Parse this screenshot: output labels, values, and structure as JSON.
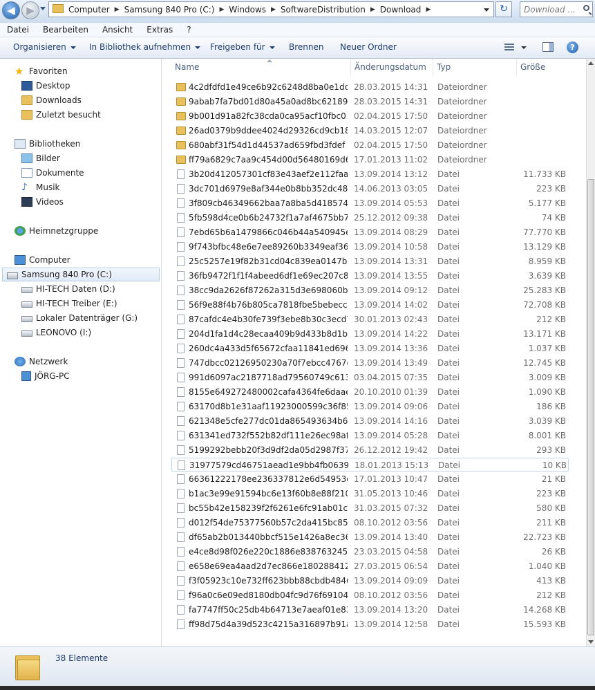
{
  "address": {
    "breadcrumbs": [
      "Computer",
      "Samsung 840 Pro (C:)",
      "Windows",
      "SoftwareDistribution",
      "Download"
    ],
    "search_placeholder": "Download ...",
    "refresh_symbol": "↻"
  },
  "nav_buttons": {
    "back": "◀",
    "forward": "▶"
  },
  "menu": [
    "Datei",
    "Bearbeiten",
    "Ansicht",
    "Extras",
    "?"
  ],
  "commands": {
    "organize": "Organisieren",
    "library": "In Bibliothek aufnehmen",
    "share": "Freigeben für",
    "burn": "Brennen",
    "new_folder": "Neuer Ordner",
    "help": "?"
  },
  "nav": {
    "favorites": "Favoriten",
    "desktop": "Desktop",
    "downloads": "Downloads",
    "recent": "Zuletzt besucht",
    "libraries": "Bibliotheken",
    "pictures": "Bilder",
    "documents": "Dokumente",
    "music": "Musik",
    "videos": "Videos",
    "homegroup": "Heimnetzgruppe",
    "computer": "Computer",
    "drive_c": "Samsung 840 Pro (C:)",
    "drive_d": "HI-TECH Daten (D:)",
    "drive_e": "HI-TECH Treiber (E:)",
    "drive_g": "Lokaler Datenträger (G:)",
    "drive_i": "LEONOVO (I:)",
    "network": "Netzwerk",
    "network_pc": "JÖRG-PC"
  },
  "columns": {
    "name": "Name",
    "date": "Änderungsdatum",
    "type": "Typ",
    "size": "Größe"
  },
  "files": [
    {
      "name": "4c2dfdfd1e49ce6b92c6248d8ba0e1dc",
      "date": "28.03.2015 14:31",
      "type": "Dateiordner",
      "size": "",
      "kind": "folder"
    },
    {
      "name": "9abab7fa7bd01d80a45a0ad8bc62189c",
      "date": "28.03.2015 14:31",
      "type": "Dateiordner",
      "size": "",
      "kind": "folder"
    },
    {
      "name": "9b001d91a82fc38cda0ca95acf10fbc0",
      "date": "02.04.2015 17:50",
      "type": "Dateiordner",
      "size": "",
      "kind": "folder"
    },
    {
      "name": "26ad0379b9ddee4024d29326cd9cb18d",
      "date": "14.03.2015 12:07",
      "type": "Dateiordner",
      "size": "",
      "kind": "folder"
    },
    {
      "name": "680abf31f54d1d44537ad659fbd3fdef",
      "date": "02.04.2015 17:50",
      "type": "Dateiordner",
      "size": "",
      "kind": "folder"
    },
    {
      "name": "ff79a6829c7aa9c454d00d56480169d6",
      "date": "17.01.2013 11:02",
      "type": "Dateiordner",
      "size": "",
      "kind": "folder"
    },
    {
      "name": "3b20d412057301cf83e43aef2e112faaab0d...",
      "date": "13.09.2014 13:12",
      "type": "Datei",
      "size": "11.733 KB",
      "kind": "file"
    },
    {
      "name": "3dc701d6979e8af344e0b8bb352dc482724...",
      "date": "14.06.2013 03:05",
      "type": "Datei",
      "size": "223 KB",
      "kind": "file"
    },
    {
      "name": "3f809cb46349662baa7a8ba5d41857430ad...",
      "date": "13.09.2014 05:53",
      "type": "Datei",
      "size": "5.177 KB",
      "kind": "file"
    },
    {
      "name": "5fb598d4ce0b6b24732f1a7af4675bb74480...",
      "date": "25.12.2012 09:38",
      "type": "Datei",
      "size": "74 KB",
      "kind": "file"
    },
    {
      "name": "7ebd65b6a1479866c046b44a540945ef2aa...",
      "date": "13.09.2014 08:29",
      "type": "Datei",
      "size": "77.770 KB",
      "kind": "file"
    },
    {
      "name": "9f743bfbc48e6e7ee89260b3349eaf36eb42...",
      "date": "13.09.2014 10:58",
      "type": "Datei",
      "size": "13.129 KB",
      "kind": "file"
    },
    {
      "name": "25c5257e19f82b31cd04c839ea0147b646a8...",
      "date": "13.09.2014 13:31",
      "type": "Datei",
      "size": "8.959 KB",
      "kind": "file"
    },
    {
      "name": "36fb9472f1f1f4abeed6df1e69ec207c86f3c...",
      "date": "13.09.2014 13:55",
      "type": "Datei",
      "size": "3.639 KB",
      "kind": "file"
    },
    {
      "name": "38cc9da2626f87262a315d3e698060b15283...",
      "date": "13.09.2014 09:12",
      "type": "Datei",
      "size": "25.283 KB",
      "kind": "file"
    },
    {
      "name": "56f9e88f4b76b805ca7818fbe5bebecc5e12...",
      "date": "13.09.2014 14:02",
      "type": "Datei",
      "size": "72.708 KB",
      "kind": "file"
    },
    {
      "name": "87cafdc4e4b30fe739f3ebe8b30c3ecd72da...",
      "date": "30.01.2013 02:43",
      "type": "Datei",
      "size": "212 KB",
      "kind": "file"
    },
    {
      "name": "204d1fa1d4c28ecaa409b9d433b8d1bb9ab...",
      "date": "13.09.2014 14:22",
      "type": "Datei",
      "size": "13.171 KB",
      "kind": "file"
    },
    {
      "name": "260dc4a433d5f65672cfaa11841ed6962c53...",
      "date": "13.09.2014 13:36",
      "type": "Datei",
      "size": "1.037 KB",
      "kind": "file"
    },
    {
      "name": "747dbcc02126950230a70f7ebcc4767c306c...",
      "date": "13.09.2014 13:49",
      "type": "Datei",
      "size": "12.745 KB",
      "kind": "file"
    },
    {
      "name": "991d6097ac2187718ad79560749c613f4a14...",
      "date": "03.04.2015 07:35",
      "type": "Datei",
      "size": "3.009 KB",
      "kind": "file"
    },
    {
      "name": "8155e649272480002cafa4364fe6daae6185...",
      "date": "20.10.2010 01:39",
      "type": "Datei",
      "size": "1.090 KB",
      "kind": "file"
    },
    {
      "name": "63170d8b1e31aaf11923000599c36f857d2a...",
      "date": "13.09.2014 09:06",
      "type": "Datei",
      "size": "186 KB",
      "kind": "file"
    },
    {
      "name": "621348e5cfe277dc01da865493634b6b9d9...",
      "date": "13.09.2014 14:16",
      "type": "Datei",
      "size": "3.039 KB",
      "kind": "file"
    },
    {
      "name": "631341ed732f552b82df111e26ec98af61bf...",
      "date": "13.09.2014 05:28",
      "type": "Datei",
      "size": "8.001 KB",
      "kind": "file"
    },
    {
      "name": "5199292bebb20f3d9df2da05d2987f374c4f...",
      "date": "26.12.2012 19:42",
      "type": "Datei",
      "size": "293 KB",
      "kind": "file"
    },
    {
      "name": "31977579cd46751aead1e9bb4fb0639c478...",
      "date": "18.01.2013 15:13",
      "type": "Datei",
      "size": "10 KB",
      "kind": "file",
      "selected": true
    },
    {
      "name": "66361222178ee236337812e6d54953ef4585...",
      "date": "17.01.2013 10:47",
      "type": "Datei",
      "size": "21 KB",
      "kind": "file"
    },
    {
      "name": "b1ac3e99e91594bc6e13f60b8e88f210b48d...",
      "date": "31.05.2013 10:46",
      "type": "Datei",
      "size": "223 KB",
      "kind": "file"
    },
    {
      "name": "bc55b42e158239f2f6261e6fc91ab01c458e...",
      "date": "31.03.2015 07:32",
      "type": "Datei",
      "size": "580 KB",
      "kind": "file"
    },
    {
      "name": "d012f54de75377560b57c2da415bc85cfc23...",
      "date": "08.10.2012 03:56",
      "type": "Datei",
      "size": "211 KB",
      "kind": "file"
    },
    {
      "name": "df65ab2b013440bbcf515e1426a8ec36e2d...",
      "date": "13.09.2014 13:40",
      "type": "Datei",
      "size": "22.723 KB",
      "kind": "file"
    },
    {
      "name": "e4ce8d98f026e220c1886e8387632453e15a...",
      "date": "23.03.2015 04:58",
      "type": "Datei",
      "size": "26 KB",
      "kind": "file"
    },
    {
      "name": "e658e69ea4aad2d7ec866e180288412c549...",
      "date": "27.03.2015 06:54",
      "type": "Datei",
      "size": "1.040 KB",
      "kind": "file"
    },
    {
      "name": "f3f05923c10e732ff623bbb88cbdb4846b65...",
      "date": "13.09.2014 09:09",
      "type": "Datei",
      "size": "413 KB",
      "kind": "file"
    },
    {
      "name": "f96a0c6e09ed8180db04fc9d76f691040cea...",
      "date": "08.10.2012 03:56",
      "type": "Datei",
      "size": "212 KB",
      "kind": "file"
    },
    {
      "name": "fa7747ff50c25db4b64713e7aeaf01e835045...",
      "date": "13.09.2014 13:20",
      "type": "Datei",
      "size": "14.268 KB",
      "kind": "file"
    },
    {
      "name": "ff98d75d4a39d523c4215a316897b91acf1c...",
      "date": "13.09.2014 12:58",
      "type": "Datei",
      "size": "15.593 KB",
      "kind": "file"
    }
  ],
  "status": {
    "count": "38 Elemente"
  },
  "colors": {
    "accent": "#1e3c6a",
    "folder": "#e9c15c",
    "selection_border": "#c3d3e8"
  }
}
